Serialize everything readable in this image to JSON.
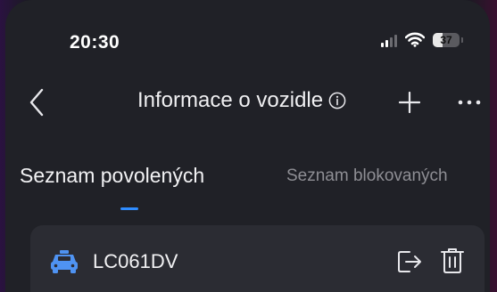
{
  "status_bar": {
    "time": "20:30",
    "battery_level": "37",
    "battery_fraction": 0.37,
    "signal_icon": "signal-bars-icon",
    "wifi_icon": "wifi-icon"
  },
  "header": {
    "title": "Informace o vozidle",
    "back_icon": "chevron-left-icon",
    "info_icon": "info-circle-icon",
    "add_icon": "plus-icon",
    "more_icon": "more-horizontal-icon"
  },
  "tabs": [
    {
      "label": "Seznam povolených",
      "active": true
    },
    {
      "label": "Seznam blokovaných",
      "active": false
    }
  ],
  "vehicles": [
    {
      "plate": "LC061DV",
      "icon": "car-icon",
      "actions": [
        "export-icon",
        "trash-icon"
      ]
    }
  ],
  "colors": {
    "accent": "#2f8cff",
    "car_icon": "#4f93f2",
    "background": "#202127",
    "card": "#2b2c33"
  }
}
